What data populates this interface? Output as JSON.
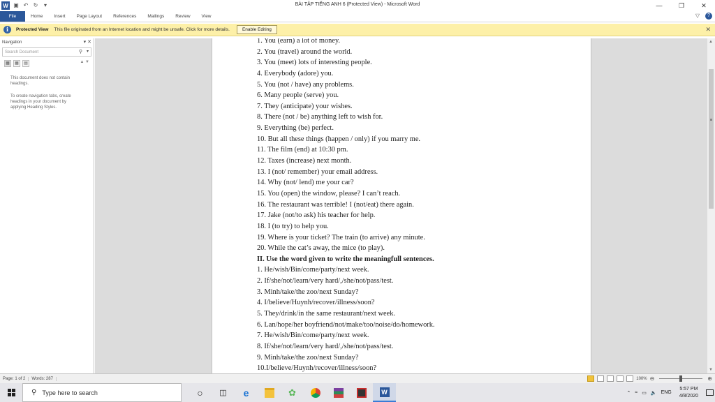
{
  "window": {
    "title": "BÀI TẬP TIẾNG ANH 6 (Protected View) - Microsoft Word"
  },
  "ribbon": {
    "file": "File",
    "tabs": [
      "Home",
      "Insert",
      "Page Layout",
      "References",
      "Mailings",
      "Review",
      "View"
    ]
  },
  "protected_bar": {
    "title": "Protected View",
    "message": "This file originated from an Internet location and might be unsafe. Click for more details.",
    "button": "Enable Editing"
  },
  "navigation": {
    "title": "Navigation",
    "search_placeholder": "Search Document",
    "message1": "This document does not contain headings.",
    "message2": "To create navigation tabs, create headings in your document by applying Heading Styles."
  },
  "document": {
    "lines": [
      {
        "text": "1. You (earn) a lot of money.",
        "bold": false
      },
      {
        "text": "2. You (travel) around the world.",
        "bold": false
      },
      {
        "text": "3. You (meet) lots of interesting people.",
        "bold": false
      },
      {
        "text": "4. Everybody (adore) you.",
        "bold": false
      },
      {
        "text": "5. You (not / have) any problems.",
        "bold": false
      },
      {
        "text": "6. Many people (serve) you.",
        "bold": false
      },
      {
        "text": "7. They (anticipate) your wishes.",
        "bold": false
      },
      {
        "text": "8. There (not / be) anything left to wish for.",
        "bold": false
      },
      {
        "text": "9. Everything (be) perfect.",
        "bold": false
      },
      {
        "text": "10. But all these things (happen / only) if you marry me.",
        "bold": false
      },
      {
        "text": "11. The film (end) at 10:30 pm.",
        "bold": false
      },
      {
        "text": "12. Taxes (increase) next month.",
        "bold": false
      },
      {
        "text": "13. I (not/ remember) your email address.",
        "bold": false
      },
      {
        "text": "14. Why (not/ lend) me your car?",
        "bold": false
      },
      {
        "text": "15. You (open) the window, please? I can’t reach.",
        "bold": false
      },
      {
        "text": "16. The restaurant was terrible! I (not/eat) there again.",
        "bold": false
      },
      {
        "text": "17. Jake (not/to ask) his teacher for help.",
        "bold": false
      },
      {
        "text": "18. I (to try) to help you.",
        "bold": false
      },
      {
        "text": "19. Where is your ticket? The train (to arrive) any minute.",
        "bold": false
      },
      {
        "text": "20. While the cat’s away, the mice (to play).",
        "bold": false
      },
      {
        "text": "II. Use the word given to write the meaningfull sentences.",
        "bold": true
      },
      {
        "text": "1.  He/wish/Bin/come/party/next  week.",
        "bold": false
      },
      {
        "text": "2.  If/she/not/learn/very hard/,/she/not/pass/test.",
        "bold": false
      },
      {
        "text": "3.  Minh/take/the zoo/next Sunday?",
        "bold": false
      },
      {
        "text": "4.  I/believe/Huynh/recover/illness/soon?",
        "bold": false
      },
      {
        "text": "5.  They/drink/in the same restaurant/next week.",
        "bold": false
      },
      {
        "text": "6.  Lan/hope/her boyfriend/not/make/too/noise/do/homework.",
        "bold": false
      },
      {
        "text": "7.  He/wish/Bin/come/party/next  week.",
        "bold": false
      },
      {
        "text": "8.  If/she/not/learn/very hard/,/she/not/pass/test.",
        "bold": false
      },
      {
        "text": "9.  Minh/take/the zoo/next Sunday?",
        "bold": false
      },
      {
        "text": "10.I/believe/Huynh/recover/illness/soon?",
        "bold": false
      }
    ]
  },
  "status": {
    "page": "Page: 1 of 2",
    "words": "Words: 287",
    "zoom": "100%"
  },
  "taskbar": {
    "search_placeholder": "Type here to search",
    "time": "5:57 PM",
    "date": "4/8/2020",
    "lang": "ENG"
  },
  "colors": {
    "word_blue": "#2b579a",
    "protected_bar": "#fdf0a8"
  }
}
